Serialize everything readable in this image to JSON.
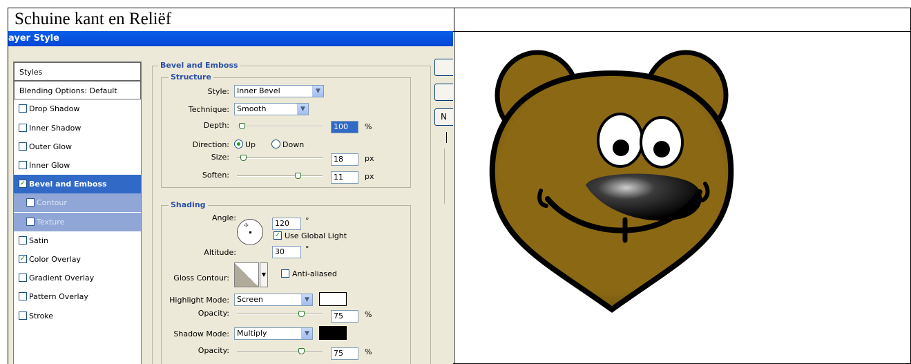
{
  "document": {
    "cell_heading": "Schuine kant en Reliëf"
  },
  "dialog": {
    "title": "ayer Style",
    "styles_list": [
      {
        "label": "Styles",
        "checkbox": null,
        "kind": "header"
      },
      {
        "label": "Blending Options: Default",
        "checkbox": null,
        "kind": "header"
      },
      {
        "label": "Drop Shadow",
        "checkbox": false,
        "kind": "item"
      },
      {
        "label": "Inner Shadow",
        "checkbox": false,
        "kind": "item"
      },
      {
        "label": "Outer Glow",
        "checkbox": false,
        "kind": "item"
      },
      {
        "label": "Inner Glow",
        "checkbox": false,
        "kind": "item"
      },
      {
        "label": "Bevel and Emboss",
        "checkbox": true,
        "kind": "selected"
      },
      {
        "label": "Contour",
        "checkbox": false,
        "kind": "sub"
      },
      {
        "label": "Texture",
        "checkbox": false,
        "kind": "sub"
      },
      {
        "label": "Satin",
        "checkbox": false,
        "kind": "item"
      },
      {
        "label": "Color Overlay",
        "checkbox": true,
        "kind": "item"
      },
      {
        "label": "Gradient Overlay",
        "checkbox": false,
        "kind": "item"
      },
      {
        "label": "Pattern Overlay",
        "checkbox": false,
        "kind": "item"
      },
      {
        "label": "Stroke",
        "checkbox": false,
        "kind": "item"
      }
    ],
    "bevel": {
      "group_title": "Bevel and Emboss",
      "structure_title": "Structure",
      "style_label": "Style:",
      "style_value": "Inner Bevel",
      "technique_label": "Technique:",
      "technique_value": "Smooth",
      "depth_label": "Depth:",
      "depth_value": "100",
      "depth_unit": "%",
      "depth_level": 0.06,
      "direction_label": "Direction:",
      "direction_up": "Up",
      "direction_down": "Down",
      "direction_selected": "Up",
      "size_label": "Size:",
      "size_value": "18",
      "size_unit": "px",
      "size_level": 0.07,
      "soften_label": "Soften:",
      "soften_value": "11",
      "soften_unit": "px",
      "soften_level": 0.71
    },
    "shading": {
      "title": "Shading",
      "angle_label": "Angle:",
      "angle_value": "120",
      "angle_unit": "°",
      "use_global_light_label": "Use Global Light",
      "use_global_light": true,
      "altitude_label": "Altitude:",
      "altitude_value": "30",
      "altitude_unit": "°",
      "gloss_contour_label": "Gloss Contour:",
      "anti_aliased_label": "Anti-aliased",
      "anti_aliased": false,
      "highlight_mode_label": "Highlight Mode:",
      "highlight_mode_value": "Screen",
      "highlight_color": "#ffffff",
      "highlight_opacity_label": "Opacity:",
      "highlight_opacity_value": "75",
      "highlight_opacity_unit": "%",
      "highlight_opacity_level": 0.75,
      "shadow_mode_label": "Shadow Mode:",
      "shadow_mode_value": "Multiply",
      "shadow_color": "#000000",
      "shadow_opacity_label": "Opacity:",
      "shadow_opacity_value": "75",
      "shadow_opacity_unit": "%",
      "shadow_opacity_level": 0.75
    },
    "side_buttons": [
      "",
      "",
      "N"
    ]
  },
  "preview": {
    "fur_color": "#8b6914",
    "outline_color": "#000000"
  }
}
